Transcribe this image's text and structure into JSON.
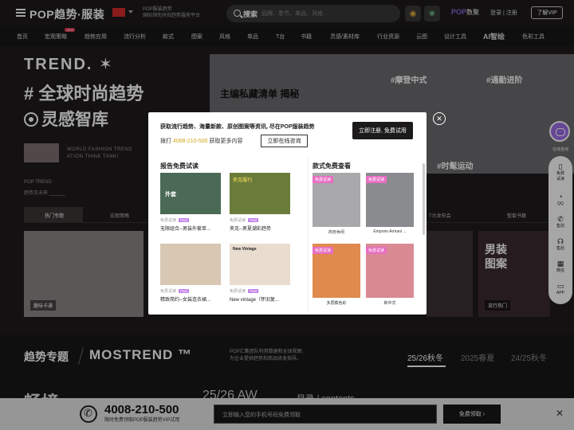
{
  "topbar": {
    "logo": "POP趋势·服装",
    "tagline": [
      "POP服装趋势",
      "国际领先时尚趋势服务平台"
    ],
    "search_label": "搜索",
    "search_placeholder": "品牌、季节、单品、风格",
    "pop_data": "POP",
    "pop_data_suffix": "数聚",
    "login": "登录 | 注册",
    "vip_button": "了解VIP"
  },
  "nav": {
    "items": [
      "首页",
      "宏观策略",
      "趋势应用",
      "流行分析",
      "款式",
      "图案",
      "风格",
      "单品",
      "T台",
      "书籍",
      "灵感/素材库",
      "行业资源",
      "云图",
      "设计工具",
      "AI智绘",
      "色彩工具"
    ],
    "badge_new": "NEW"
  },
  "hero": {
    "trend_title": "TREND. ✶",
    "h1": "# 全球时尚趋势",
    "h2": "灵感智库",
    "en_lines": [
      "WORLD FASHION TREND",
      "ATION THINK TANK!"
    ],
    "pop_trend": "POP TREND",
    "pop_trend_cn": "趋势见未来 ______",
    "panel_title": "主编私藏清单 揭秘",
    "panel_tags": [
      "#摩登中式",
      "#通勤进阶",
      "#时髦运动"
    ]
  },
  "tabs": [
    "热门专题",
    "宏观策略",
    "T台发布会",
    "整套书籍"
  ],
  "strip": {
    "labels": [
      "趣味卡通",
      "男装图案",
      "流行热门"
    ],
    "side_text": [
      "男装",
      "图案"
    ]
  },
  "topic": {
    "title": "趋势专题",
    "mostrend": "MOSTREND ™",
    "desc": [
      "POP汇集团队利用数据和全球视野,",
      "为企业提供趋势和商品研发指导。"
    ],
    "seasons": [
      "25/26秋冬",
      "2025春夏",
      "24/25秋冬"
    ],
    "bottom_big": "畅境",
    "bottom_mid": "25/26 AW",
    "bottom_contents": "目录 / contents"
  },
  "footer": {
    "phone": "4008-210-500",
    "sub": "限时免费领取POP服装趋势VIP试用",
    "input_placeholder": "立即输入您的手机号码免费领取",
    "button": "免费领取 ›",
    "close": "✕"
  },
  "sidebar": {
    "chat_label": "在线咨询",
    "items": [
      "免费试读",
      "QQ",
      "售前",
      "售后",
      "微信",
      "APP"
    ]
  },
  "modal": {
    "head": "获取流行趋势、海量新款、原创图案等资讯, 尽在POP服装趋势",
    "phone_prefix": "拨打",
    "phone": "4008-210-500",
    "phone_suffix": "获取更多内容",
    "consult": "立即在线咨询",
    "register": "立即注册, 免费试用",
    "reports_title": "报告免费试读",
    "styles_title": "款式免费查看",
    "free": "免费试读",
    "paid": "Paid",
    "reports": [
      {
        "title": "无限组合--男装外套单..."
      },
      {
        "title": "夹克--男夏潮彩趋势"
      },
      {
        "title": "精致简约--女装连衣裙..."
      },
      {
        "title": "New vintage（怀旧复..."
      }
    ],
    "report_img_text": [
      "外套",
      "夹克服刊",
      "New Vintage"
    ],
    "styles": [
      {
        "tag": "免费试读",
        "caption": "商务休闲"
      },
      {
        "tag": "免费试读",
        "caption": "Emporio Armani ..."
      },
      {
        "tag": "免费试读",
        "caption": "多层膨色彩"
      },
      {
        "tag": "免费试读",
        "caption": "新中式"
      }
    ]
  }
}
